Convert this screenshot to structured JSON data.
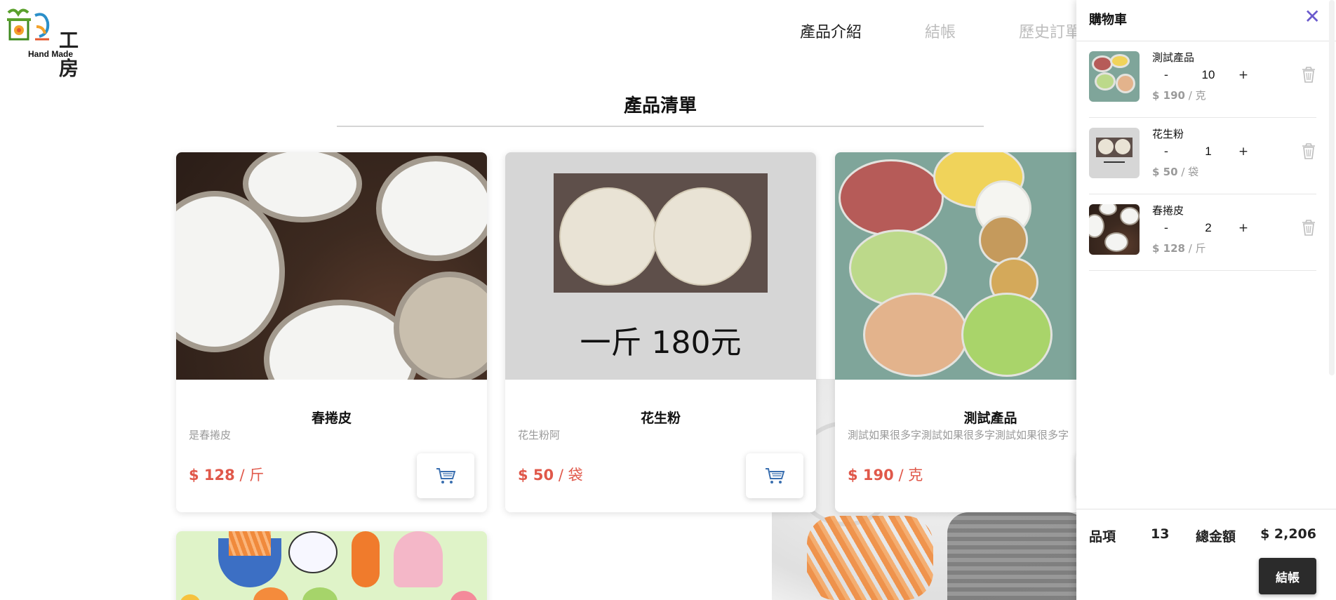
{
  "header": {
    "logo_text": "工房",
    "logo_subtitle": "Hand Made",
    "nav": [
      {
        "label": "產品介紹"
      },
      {
        "label": "結帳"
      },
      {
        "label": "歷史訂單"
      }
    ]
  },
  "section": {
    "title": "產品清單"
  },
  "products": [
    {
      "name": "春捲皮",
      "desc": "是春捲皮",
      "price": "$ 128",
      "unit": "斤"
    },
    {
      "name": "花生粉",
      "desc": "花生粉阿",
      "price": "$ 50",
      "unit": "袋",
      "image_caption": "一斤  180元"
    },
    {
      "name": "測試產品",
      "desc": "測試如果很多字測試如果很多字測試如果很多字",
      "price": "$ 190",
      "unit": "克"
    }
  ],
  "cart": {
    "title": "購物車",
    "items": [
      {
        "name": "測試產品",
        "qty": "10",
        "price": "$ 190",
        "unit": "克",
        "minus": "-",
        "plus": "+"
      },
      {
        "name": "花生粉",
        "qty": "1",
        "price": "$ 50",
        "unit": "袋",
        "minus": "-",
        "plus": "+"
      },
      {
        "name": "春捲皮",
        "qty": "2",
        "price": "$ 128",
        "unit": "斤",
        "minus": "-",
        "plus": "+"
      }
    ],
    "summary": {
      "items_label": "品項",
      "items_count": "13",
      "total_label": "總金額",
      "total_value": "$ 2,206"
    },
    "checkout_label": "結帳"
  },
  "colors": {
    "price": "#e0584a",
    "close": "#6a5acd",
    "checkout_bg": "#2b2b2b"
  }
}
